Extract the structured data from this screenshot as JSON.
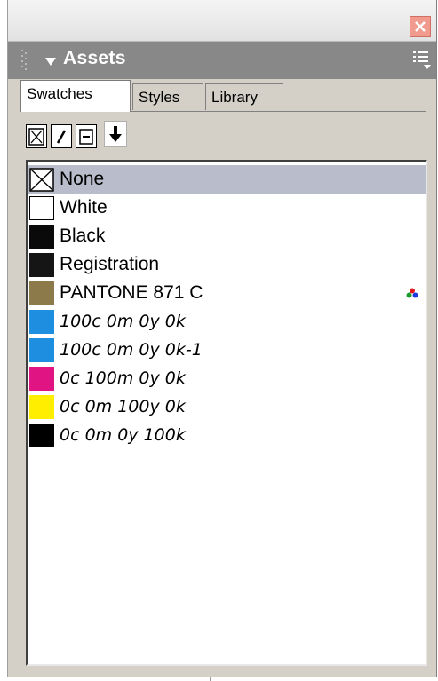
{
  "panel": {
    "title": "Assets",
    "colors": {
      "header": "#888888",
      "body": "#d4d0c8",
      "selected_row": "#b9bccb",
      "close_button": "#f19a8e"
    }
  },
  "window_controls": {
    "close_icon": "close-icon"
  },
  "tabs": [
    {
      "label": "Swatches",
      "active": true
    },
    {
      "label": "Styles",
      "active": false
    },
    {
      "label": "Library",
      "active": false
    }
  ],
  "toolbar": {
    "buttons": [
      {
        "icon": "fill-none-icon"
      },
      {
        "icon": "stroke-slash-icon"
      },
      {
        "icon": "minus-box-icon"
      },
      {
        "icon": "down-arrow-icon"
      }
    ]
  },
  "swatches": [
    {
      "label": "None",
      "color": "none",
      "style": "regular",
      "selected": true
    },
    {
      "label": "White",
      "color": "#ffffff",
      "style": "regular"
    },
    {
      "label": "Black",
      "color": "#0a0a0a",
      "style": "regular"
    },
    {
      "label": "Registration",
      "color": "#151515",
      "style": "regular"
    },
    {
      "label": "PANTONE 871 C",
      "color": "#8c7a4a",
      "style": "regular",
      "spot_icon": "spot-color-icon"
    },
    {
      "label": "100c 0m 0y 0k",
      "color": "#1e8fe0",
      "style": "italic"
    },
    {
      "label": "100c 0m 0y 0k-1",
      "color": "#1e8fe0",
      "style": "italic"
    },
    {
      "label": "0c 100m 0y 0k",
      "color": "#e01483",
      "style": "italic"
    },
    {
      "label": "0c 0m 100y 0k",
      "color": "#ffee00",
      "style": "italic"
    },
    {
      "label": "0c 0m 0y 100k",
      "color": "#000000",
      "style": "italic"
    }
  ]
}
